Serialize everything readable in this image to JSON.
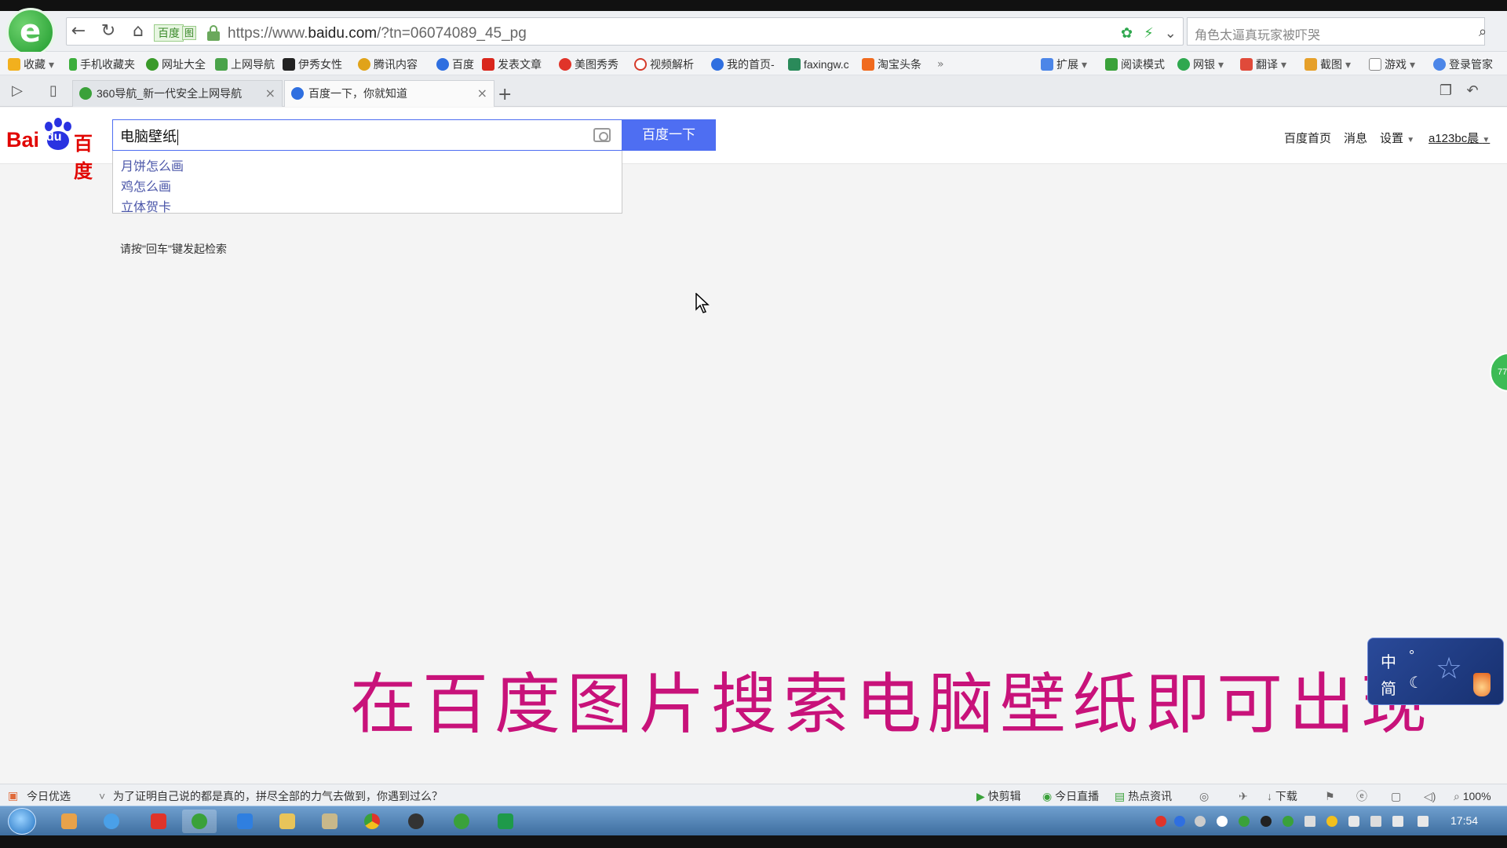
{
  "browser": {
    "address": {
      "site_badge": "百度",
      "badge_square": "图",
      "url_prefix": "https://www.",
      "url_domain": "baidu.com",
      "url_rest": "/?tn=06074089_45_pg"
    },
    "search_box_text": "角色太逼真玩家被吓哭",
    "favorites": [
      {
        "label": "收藏",
        "color": "#f2b01e"
      },
      {
        "label": "手机收藏夹",
        "color": "#3cae3c"
      },
      {
        "label": "网址大全",
        "color": "#3a9a2a"
      },
      {
        "label": "上网导航",
        "color": "#4aa34a"
      },
      {
        "label": "伊秀女性",
        "color": "#222222"
      },
      {
        "label": "腾讯内容",
        "color": "#e0a31a"
      },
      {
        "label": "百度",
        "color": "#2f6fe0"
      },
      {
        "label": "发表文章",
        "color": "#d9261c"
      },
      {
        "label": "美图秀秀",
        "color": "#e0342a"
      },
      {
        "label": "视频解析",
        "color": "#d53a2a"
      },
      {
        "label": "我的首页-",
        "color": "#2f6fe0"
      },
      {
        "label": "faxingw.c",
        "color": "#2a8a5a"
      },
      {
        "label": "淘宝头条",
        "color": "#f06a1e"
      }
    ],
    "toolbar_right": [
      "扩展",
      "阅读模式",
      "网银",
      "翻译",
      "截图",
      "游戏",
      "登录管家"
    ],
    "tabs": [
      {
        "title": "360导航_新一代安全上网导航",
        "close": "×"
      },
      {
        "title": "百度一下，你就知道",
        "close": "×"
      }
    ],
    "new_tab": "+"
  },
  "page": {
    "logo": {
      "bai": "Bai",
      "du": "du",
      "cn": "百度"
    },
    "query": "电脑壁纸",
    "search_button": "百度一下",
    "header_links": [
      "百度首页",
      "消息",
      "设置",
      "a123bc晨"
    ],
    "suggestions": [
      "月饼怎么画",
      "鸡怎么画",
      "立体贺卡"
    ],
    "tip": "请按\"回车\"键发起检索",
    "side_ball": "77"
  },
  "overlay": {
    "caption": "在百度图片搜索电脑壁纸即可出现",
    "ime": {
      "zh": "中",
      "jian": "简",
      "dot": "°",
      "moon": "☾"
    }
  },
  "status": {
    "today_pick": "今日优选",
    "headline": "为了证明自己说的都是真的，拼尽全部的力气去做到，你遇到过么？",
    "items": [
      "快剪辑",
      "今日直播",
      "热点资讯",
      "下载"
    ],
    "zoom": "100%"
  },
  "taskbar": {
    "clock": "17:54"
  },
  "colors": {
    "baidu_blue": "#4e6ef2",
    "baidu_red": "#e10602",
    "caption_magenta": "#c8127a"
  }
}
